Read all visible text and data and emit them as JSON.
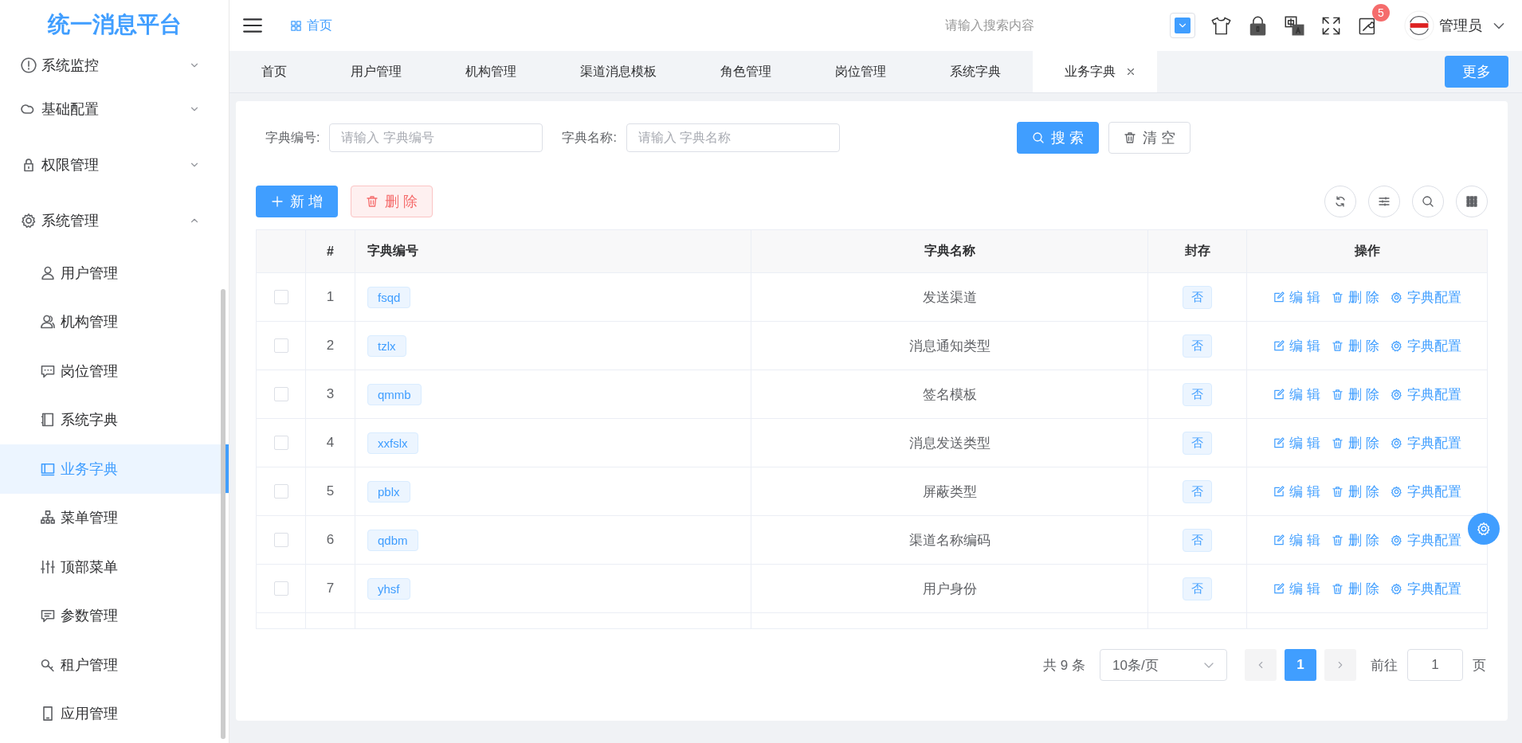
{
  "app": {
    "title": "统一消息平台"
  },
  "breadcrumb": [
    {
      "label": "首页"
    }
  ],
  "header": {
    "search_placeholder": "请输入搜索内容",
    "notification_count": "5",
    "user": "管理员"
  },
  "sidebar": {
    "items": [
      {
        "label": "系统监控",
        "expanded": false
      },
      {
        "label": "基础配置",
        "expanded": false
      },
      {
        "label": "权限管理",
        "expanded": false
      },
      {
        "label": "系统管理",
        "expanded": true,
        "children": [
          {
            "label": "用户管理",
            "selected": false
          },
          {
            "label": "机构管理",
            "selected": false
          },
          {
            "label": "岗位管理",
            "selected": false
          },
          {
            "label": "系统字典",
            "selected": false
          },
          {
            "label": "业务字典",
            "selected": true
          },
          {
            "label": "菜单管理",
            "selected": false
          },
          {
            "label": "顶部菜单",
            "selected": false
          },
          {
            "label": "参数管理",
            "selected": false
          },
          {
            "label": "租户管理",
            "selected": false
          },
          {
            "label": "应用管理",
            "selected": false
          }
        ]
      }
    ]
  },
  "tabs": [
    {
      "label": "首页",
      "selected": false
    },
    {
      "label": "用户管理",
      "selected": false
    },
    {
      "label": "机构管理",
      "selected": false
    },
    {
      "label": "渠道消息模板",
      "selected": false
    },
    {
      "label": "角色管理",
      "selected": false
    },
    {
      "label": "岗位管理",
      "selected": false
    },
    {
      "label": "系统字典",
      "selected": false
    },
    {
      "label": "业务字典",
      "selected": true
    }
  ],
  "more_button": "更多",
  "filters": [
    {
      "label": "字典编号:",
      "placeholder": "请输入 字典编号"
    },
    {
      "label": "字典名称:",
      "placeholder": "请输入 字典名称"
    }
  ],
  "search_button": "搜 索",
  "clear_button": "清 空",
  "toolbar": {
    "add": "新 增",
    "delete": "删 除"
  },
  "table": {
    "columns": [
      "#",
      "字典编号",
      "字典名称",
      "封存",
      "操作"
    ],
    "rows": [
      {
        "index": "1",
        "code": "fsqd",
        "name": "发送渠道",
        "sealed": "否",
        "checked": false,
        "actions": [
          "编 辑",
          "删 除",
          "字典配置"
        ]
      },
      {
        "index": "2",
        "code": "tzlx",
        "name": "消息通知类型",
        "sealed": "否",
        "checked": false,
        "actions": [
          "编 辑",
          "删 除",
          "字典配置"
        ]
      },
      {
        "index": "3",
        "code": "qmmb",
        "name": "签名模板",
        "sealed": "否",
        "checked": false,
        "actions": [
          "编 辑",
          "删 除",
          "字典配置"
        ]
      },
      {
        "index": "4",
        "code": "xxfslx",
        "name": "消息发送类型",
        "sealed": "否",
        "checked": false,
        "actions": [
          "编 辑",
          "删 除",
          "字典配置"
        ]
      },
      {
        "index": "5",
        "code": "pblx",
        "name": "屏蔽类型",
        "sealed": "否",
        "checked": false,
        "actions": [
          "编 辑",
          "删 除",
          "字典配置"
        ]
      },
      {
        "index": "6",
        "code": "qdbm",
        "name": "渠道名称编码",
        "sealed": "否",
        "checked": false,
        "actions": [
          "编 辑",
          "删 除",
          "字典配置"
        ]
      },
      {
        "index": "7",
        "code": "yhsf",
        "name": "用户身份",
        "sealed": "否",
        "checked": false,
        "actions": [
          "编 辑",
          "删 除",
          "字典配置"
        ]
      }
    ]
  },
  "pagination": {
    "total": "共 9 条",
    "page_size": "10条/页",
    "pages": [
      {
        "label": "1",
        "selected": true
      }
    ],
    "goto_label": "前往",
    "goto_value": "1",
    "page_suffix": "页"
  }
}
